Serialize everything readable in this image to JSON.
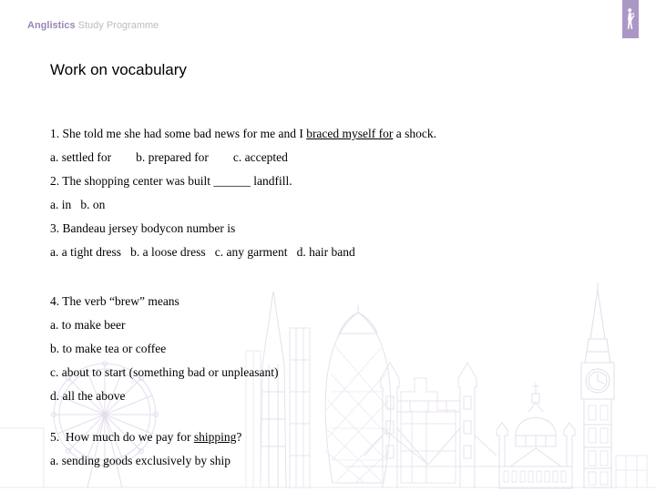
{
  "brand": {
    "strong": "Anglistics",
    "light": " Study Programme",
    "strong_color": "#9b86b8",
    "light_color": "#bdbdbd",
    "logo_icon": "walking-person-icon",
    "logo_bg_color": "#ab97c6"
  },
  "page": {
    "title": "Work on vocabulary",
    "background_color": "#ffffff",
    "text_color": "#000000"
  },
  "watermark": {
    "name": "london-skyline-watermark",
    "stroke_color": "#e6e0ee",
    "landmarks": [
      "london-eye",
      "the-shard",
      "the-gherkin",
      "tower-bridge",
      "st-pauls-cathedral",
      "big-ben"
    ]
  },
  "quiz": {
    "items": [
      {
        "number": "1.",
        "question_pre": "1. She told me she had some bad news for me and I ",
        "question_underlined": "braced myself for",
        "question_post": " a shock.",
        "options_line": "a. settled for        b. prepared for        c. accepted"
      },
      {
        "number": "2.",
        "question_pre": "2. The shopping center was built ______ landfill.",
        "question_underlined": "",
        "question_post": "",
        "options_line": "a. in   b. on"
      },
      {
        "number": "3.",
        "question_pre": "3. Bandeau jersey bodycon number is",
        "question_underlined": "",
        "question_post": "",
        "options_line": "a. a tight dress   b. a loose dress   c. any garment   d. hair band"
      }
    ],
    "item4": {
      "question": "4. The verb “brew” means",
      "options": [
        "a. to make beer",
        "b. to make tea or coffee",
        "c. about to start (something bad or unpleasant)",
        "d. all the above"
      ]
    },
    "item5": {
      "question_pre": "5.  How much do we pay for ",
      "question_underlined": "shipping",
      "question_post": "?",
      "options": [
        "a. sending goods exclusively by ship"
      ]
    }
  }
}
